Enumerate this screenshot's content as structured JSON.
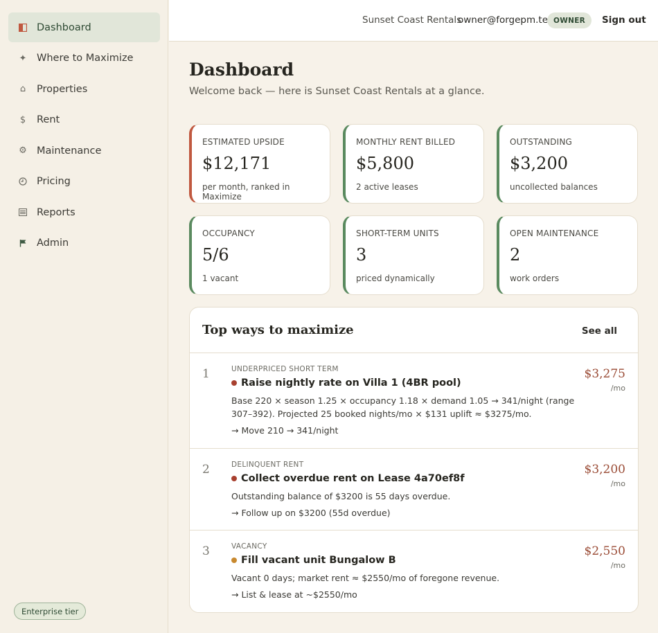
{
  "sidebar": {
    "items": [
      {
        "label": "Dashboard",
        "icon": "panel-icon",
        "active": true
      },
      {
        "label": "Where to Maximize",
        "icon": "sparkle-icon"
      },
      {
        "label": "Properties",
        "icon": "home-icon"
      },
      {
        "label": "Rent",
        "icon": "dollar-icon"
      },
      {
        "label": "Maintenance",
        "icon": "gear-icon"
      },
      {
        "label": "Pricing",
        "icon": "clock-icon"
      },
      {
        "label": "Reports",
        "icon": "list-icon"
      },
      {
        "label": "Admin",
        "icon": "flag-icon"
      }
    ],
    "tier_badge": "Enterprise tier"
  },
  "topbar": {
    "org": "Sunset Coast Rentals",
    "email": "owner@forgepm.test",
    "role": "OWNER",
    "signout": "Sign out"
  },
  "page": {
    "title": "Dashboard",
    "subtitle": "Welcome back — here is Sunset Coast Rentals at a glance."
  },
  "cards": [
    {
      "label": "ESTIMATED UPSIDE",
      "value": "$12,171",
      "note": "per month, ranked in Maximize",
      "accent": "#c0583f"
    },
    {
      "label": "MONTHLY RENT BILLED",
      "value": "$5,800",
      "note": "2 active leases",
      "accent": "#5a8a5f"
    },
    {
      "label": "OUTSTANDING",
      "value": "$3,200",
      "note": "uncollected balances",
      "accent": "#5a8a5f"
    },
    {
      "label": "OCCUPANCY",
      "value": "5/6",
      "note": "1 vacant",
      "accent": "#5a8a5f"
    },
    {
      "label": "SHORT-TERM UNITS",
      "value": "3",
      "note": "priced dynamically",
      "accent": "#5a8a5f"
    },
    {
      "label": "OPEN MAINTENANCE",
      "value": "2",
      "note": "work orders",
      "accent": "#5a8a5f"
    }
  ],
  "maximize": {
    "title": "Top ways to maximize",
    "see_all": "See all",
    "items": [
      {
        "rank": "1",
        "category": "UNDERPRICED SHORT TERM",
        "title": "Raise nightly rate on Villa 1 (4BR pool)",
        "dot_color": "#a8402f",
        "description": "Base 220 × season 1.25 × occupancy 1.18 × demand 1.05 → 341/night (range 307–392). Projected 25 booked nights/mo × $131 uplift ≈ $3275/mo.",
        "action": "→ Move 210 → 341/night",
        "amount": "$3,275",
        "per": "/mo"
      },
      {
        "rank": "2",
        "category": "DELINQUENT RENT",
        "title": "Collect overdue rent on Lease 4a70ef8f",
        "dot_color": "#a8402f",
        "description": "Outstanding balance of $3200 is 55 days overdue.",
        "action": "→ Follow up on $3200 (55d overdue)",
        "amount": "$3,200",
        "per": "/mo"
      },
      {
        "rank": "3",
        "category": "VACANCY",
        "title": "Fill vacant unit Bungalow B",
        "dot_color": "#c8892f",
        "description": "Vacant 0 days; market rent ≈ $2550/mo of foregone revenue.",
        "action": "→ List & lease at ~$2550/mo",
        "amount": "$2,550",
        "per": "/mo"
      }
    ]
  }
}
